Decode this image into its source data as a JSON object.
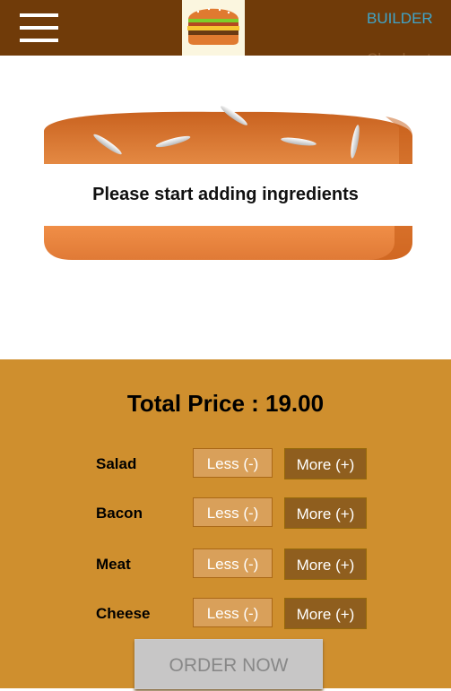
{
  "navbar": {
    "logo_icon": "burger-logo-icon",
    "menu_icon": "hamburger-menu-icon",
    "links": [
      {
        "label": "BUILDER",
        "active": true,
        "color": "#40a4c8"
      },
      {
        "label": "Checkout",
        "active": false,
        "color": "#8f5c2c"
      }
    ],
    "background": "#703b09"
  },
  "burger": {
    "message": "Please start adding ingredients",
    "top_bun_color": "#d7752a",
    "bottom_bun_color": "#e48943"
  },
  "build_controls": {
    "background": "#cf8f2e",
    "price_label": "Total Price : ",
    "price_value": "19.00",
    "controls": [
      {
        "label": "Salad",
        "less_label": "Less (-)",
        "more_label": "More (+)"
      },
      {
        "label": "Bacon",
        "less_label": "Less (-)",
        "more_label": "More (+)"
      },
      {
        "label": "Meat",
        "less_label": "Less (-)",
        "more_label": "More (+)"
      },
      {
        "label": "Cheese",
        "less_label": "Less (-)",
        "more_label": "More (+)"
      }
    ],
    "order_label": "ORDER NOW",
    "order_disabled": true
  }
}
